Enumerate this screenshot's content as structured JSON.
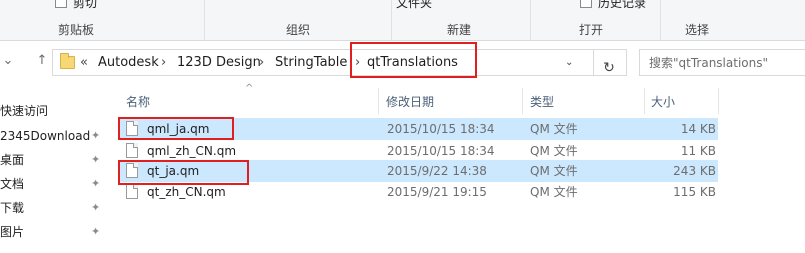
{
  "ribbon": {
    "partial_top": [
      "剪切",
      "文件夹",
      "历史记录"
    ],
    "groups": [
      "剪贴板",
      "组织",
      "新建",
      "打开",
      "选择"
    ]
  },
  "breadcrumb": {
    "overflow": "«",
    "items": [
      "Autodesk",
      "123D Design",
      "StringTable",
      "qtTranslations"
    ]
  },
  "search": {
    "placeholder": "搜索\"qtTranslations\""
  },
  "sidebar": {
    "items": [
      {
        "label": "快速访问",
        "pinned": false
      },
      {
        "label": "2345Download",
        "pinned": true
      },
      {
        "label": "桌面",
        "pinned": true
      },
      {
        "label": "文档",
        "pinned": true
      },
      {
        "label": "下载",
        "pinned": true
      },
      {
        "label": "图片",
        "pinned": true
      }
    ]
  },
  "columns": {
    "name": "名称",
    "date": "修改日期",
    "type": "类型",
    "size": "大小"
  },
  "files": [
    {
      "name": "qml_ja.qm",
      "date": "2015/10/15 18:34",
      "type": "QM 文件",
      "size": "14 KB",
      "selected": true
    },
    {
      "name": "qml_zh_CN.qm",
      "date": "2015/10/15 18:34",
      "type": "QM 文件",
      "size": "11 KB",
      "selected": false
    },
    {
      "name": "qt_ja.qm",
      "date": "2015/9/22 14:38",
      "type": "QM 文件",
      "size": "243 KB",
      "selected": true
    },
    {
      "name": "qt_zh_CN.qm",
      "date": "2015/9/21 19:15",
      "type": "QM 文件",
      "size": "115 KB",
      "selected": false
    }
  ],
  "colors": {
    "selection": "#cce8ff",
    "highlight": "#e02020",
    "header_text": "#4c607a"
  }
}
